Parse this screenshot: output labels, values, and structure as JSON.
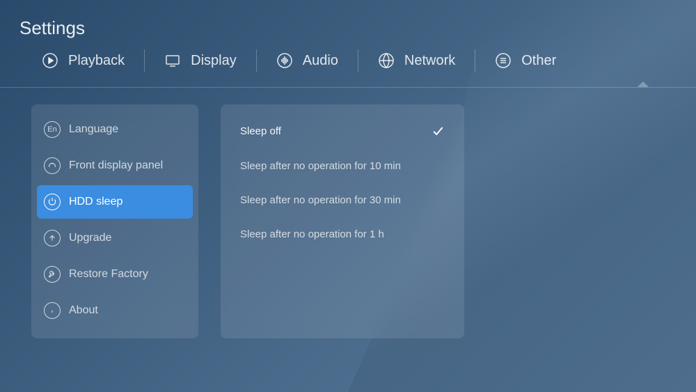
{
  "title": "Settings",
  "tabs": [
    {
      "label": "Playback",
      "icon": "play"
    },
    {
      "label": "Display",
      "icon": "display"
    },
    {
      "label": "Audio",
      "icon": "audio"
    },
    {
      "label": "Network",
      "icon": "network"
    },
    {
      "label": "Other",
      "icon": "menu",
      "active": true
    }
  ],
  "sidebar": {
    "items": [
      {
        "label": "Language",
        "icon": "en",
        "selected": false
      },
      {
        "label": "Front display panel",
        "icon": "gauge",
        "selected": false
      },
      {
        "label": "HDD sleep",
        "icon": "power",
        "selected": true
      },
      {
        "label": "Upgrade",
        "icon": "up-arrow",
        "selected": false
      },
      {
        "label": "Restore Factory",
        "icon": "wrench",
        "selected": false
      },
      {
        "label": "About",
        "icon": "info",
        "selected": false
      }
    ]
  },
  "options": [
    {
      "label": "Sleep off",
      "selected": true
    },
    {
      "label": "Sleep after no operation for 10 min",
      "selected": false
    },
    {
      "label": "Sleep after no operation for 30 min",
      "selected": false
    },
    {
      "label": "Sleep after no operation for 1 h",
      "selected": false
    }
  ]
}
